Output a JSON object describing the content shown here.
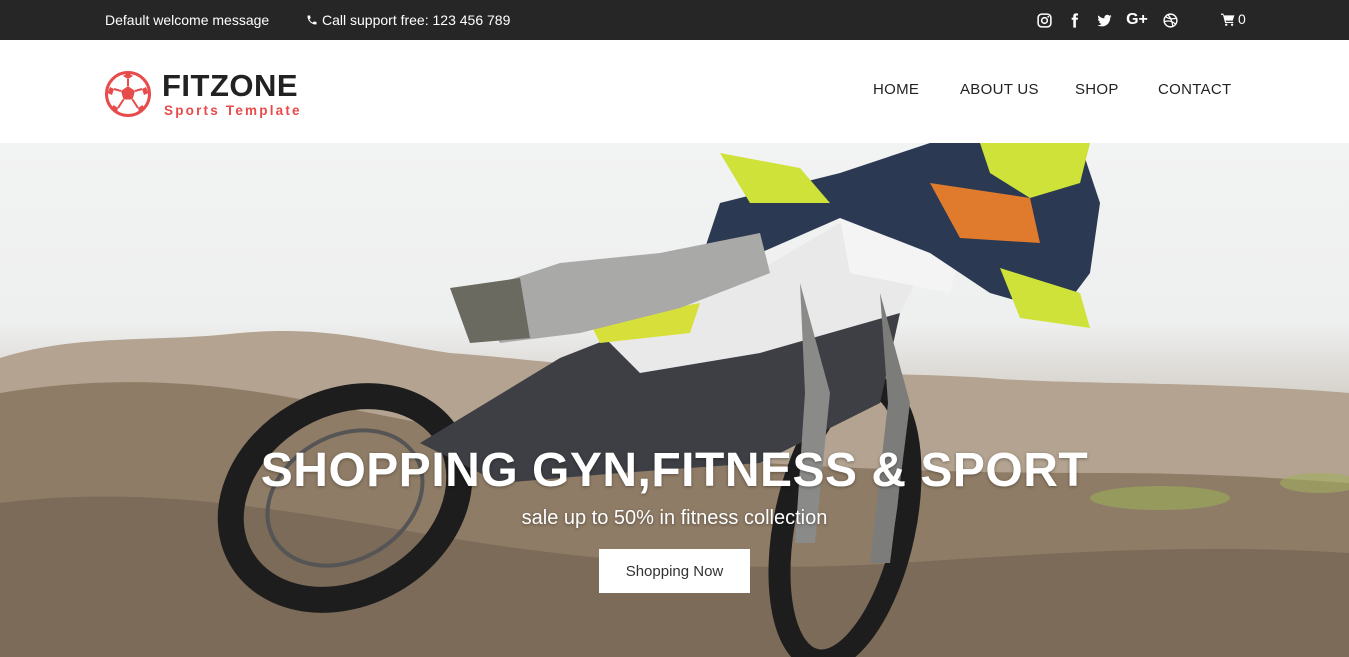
{
  "topbar": {
    "welcome": "Default welcome message",
    "support": "Call support free: 123 456 789",
    "social": [
      "instagram-icon",
      "facebook-icon",
      "twitter-icon",
      "google-plus-icon",
      "dribbble-icon"
    ],
    "gplus_text": "G+",
    "cart_count": "0"
  },
  "header": {
    "logo_name": "FITZONE",
    "logo_tagline": "Sports Template",
    "nav": [
      "HOME",
      "ABOUT US",
      "SHOP",
      "CONTACT"
    ]
  },
  "hero": {
    "title": "SHOPPING GYN,FITNESS & SPORT",
    "subtitle": "sale up to 50% in fitness collection",
    "button": "Shopping Now"
  },
  "colors": {
    "topbar_bg": "#262626",
    "accent": "#e84b4b",
    "text_dark": "#222222"
  }
}
